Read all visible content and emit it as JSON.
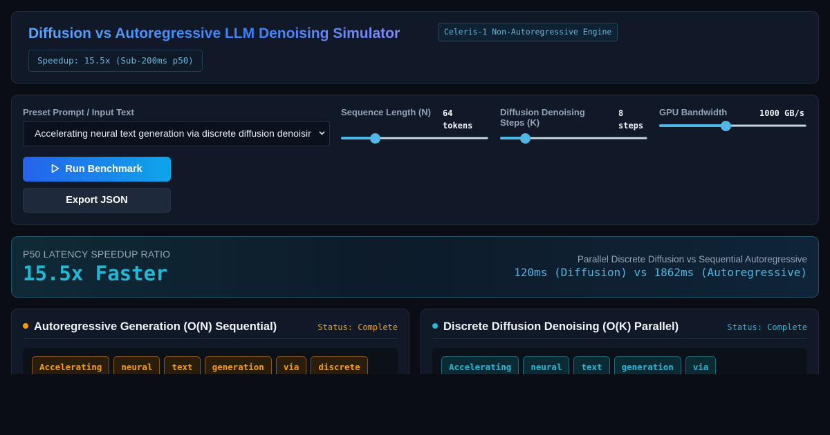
{
  "header": {
    "title": "Diffusion vs Autoregressive LLM Denoising Simulator",
    "engine_badge": "Celeris-1 Non-Autoregressive Engine",
    "speedup_badge": "Speedup: 15.5x (Sub-200ms p50)"
  },
  "controls": {
    "prompt_label": "Preset Prompt / Input Text",
    "prompt_value": "Accelerating neural text generation via discrete diffusion denoising",
    "seq_label": "Sequence Length (N)",
    "seq_value": "64 tokens",
    "seq_fraction": 0.23,
    "steps_label": "Diffusion Denoising Steps (K)",
    "steps_value": "8 steps",
    "steps_fraction": 0.17,
    "bw_label": "GPU Bandwidth",
    "bw_value": "1000 GB/s",
    "bw_fraction": 0.45,
    "run_label": "Run Benchmark",
    "export_label": "Export JSON"
  },
  "hero": {
    "label": "P50 LATENCY SPEEDUP RATIO",
    "value": "15.5x Faster",
    "subtitle": "Parallel Discrete Diffusion vs Sequential Autoregressive",
    "detail": "120ms (Diffusion) vs 1862ms (Autoregressive)"
  },
  "ar_panel": {
    "title": "Autoregressive Generation (O(N) Sequential)",
    "status": "Status: Complete",
    "tokens": [
      "Accelerating",
      "neural",
      "text",
      "generation",
      "via",
      "discrete"
    ]
  },
  "diff_panel": {
    "title": "Discrete Diffusion Denoising (O(K) Parallel)",
    "status": "Status: Complete",
    "tokens": [
      "Accelerating",
      "neural",
      "text",
      "generation",
      "via"
    ]
  },
  "colors": {
    "accent": "#4fb6e6",
    "ar": "#f59e0b",
    "diffusion": "#22b8d6"
  }
}
